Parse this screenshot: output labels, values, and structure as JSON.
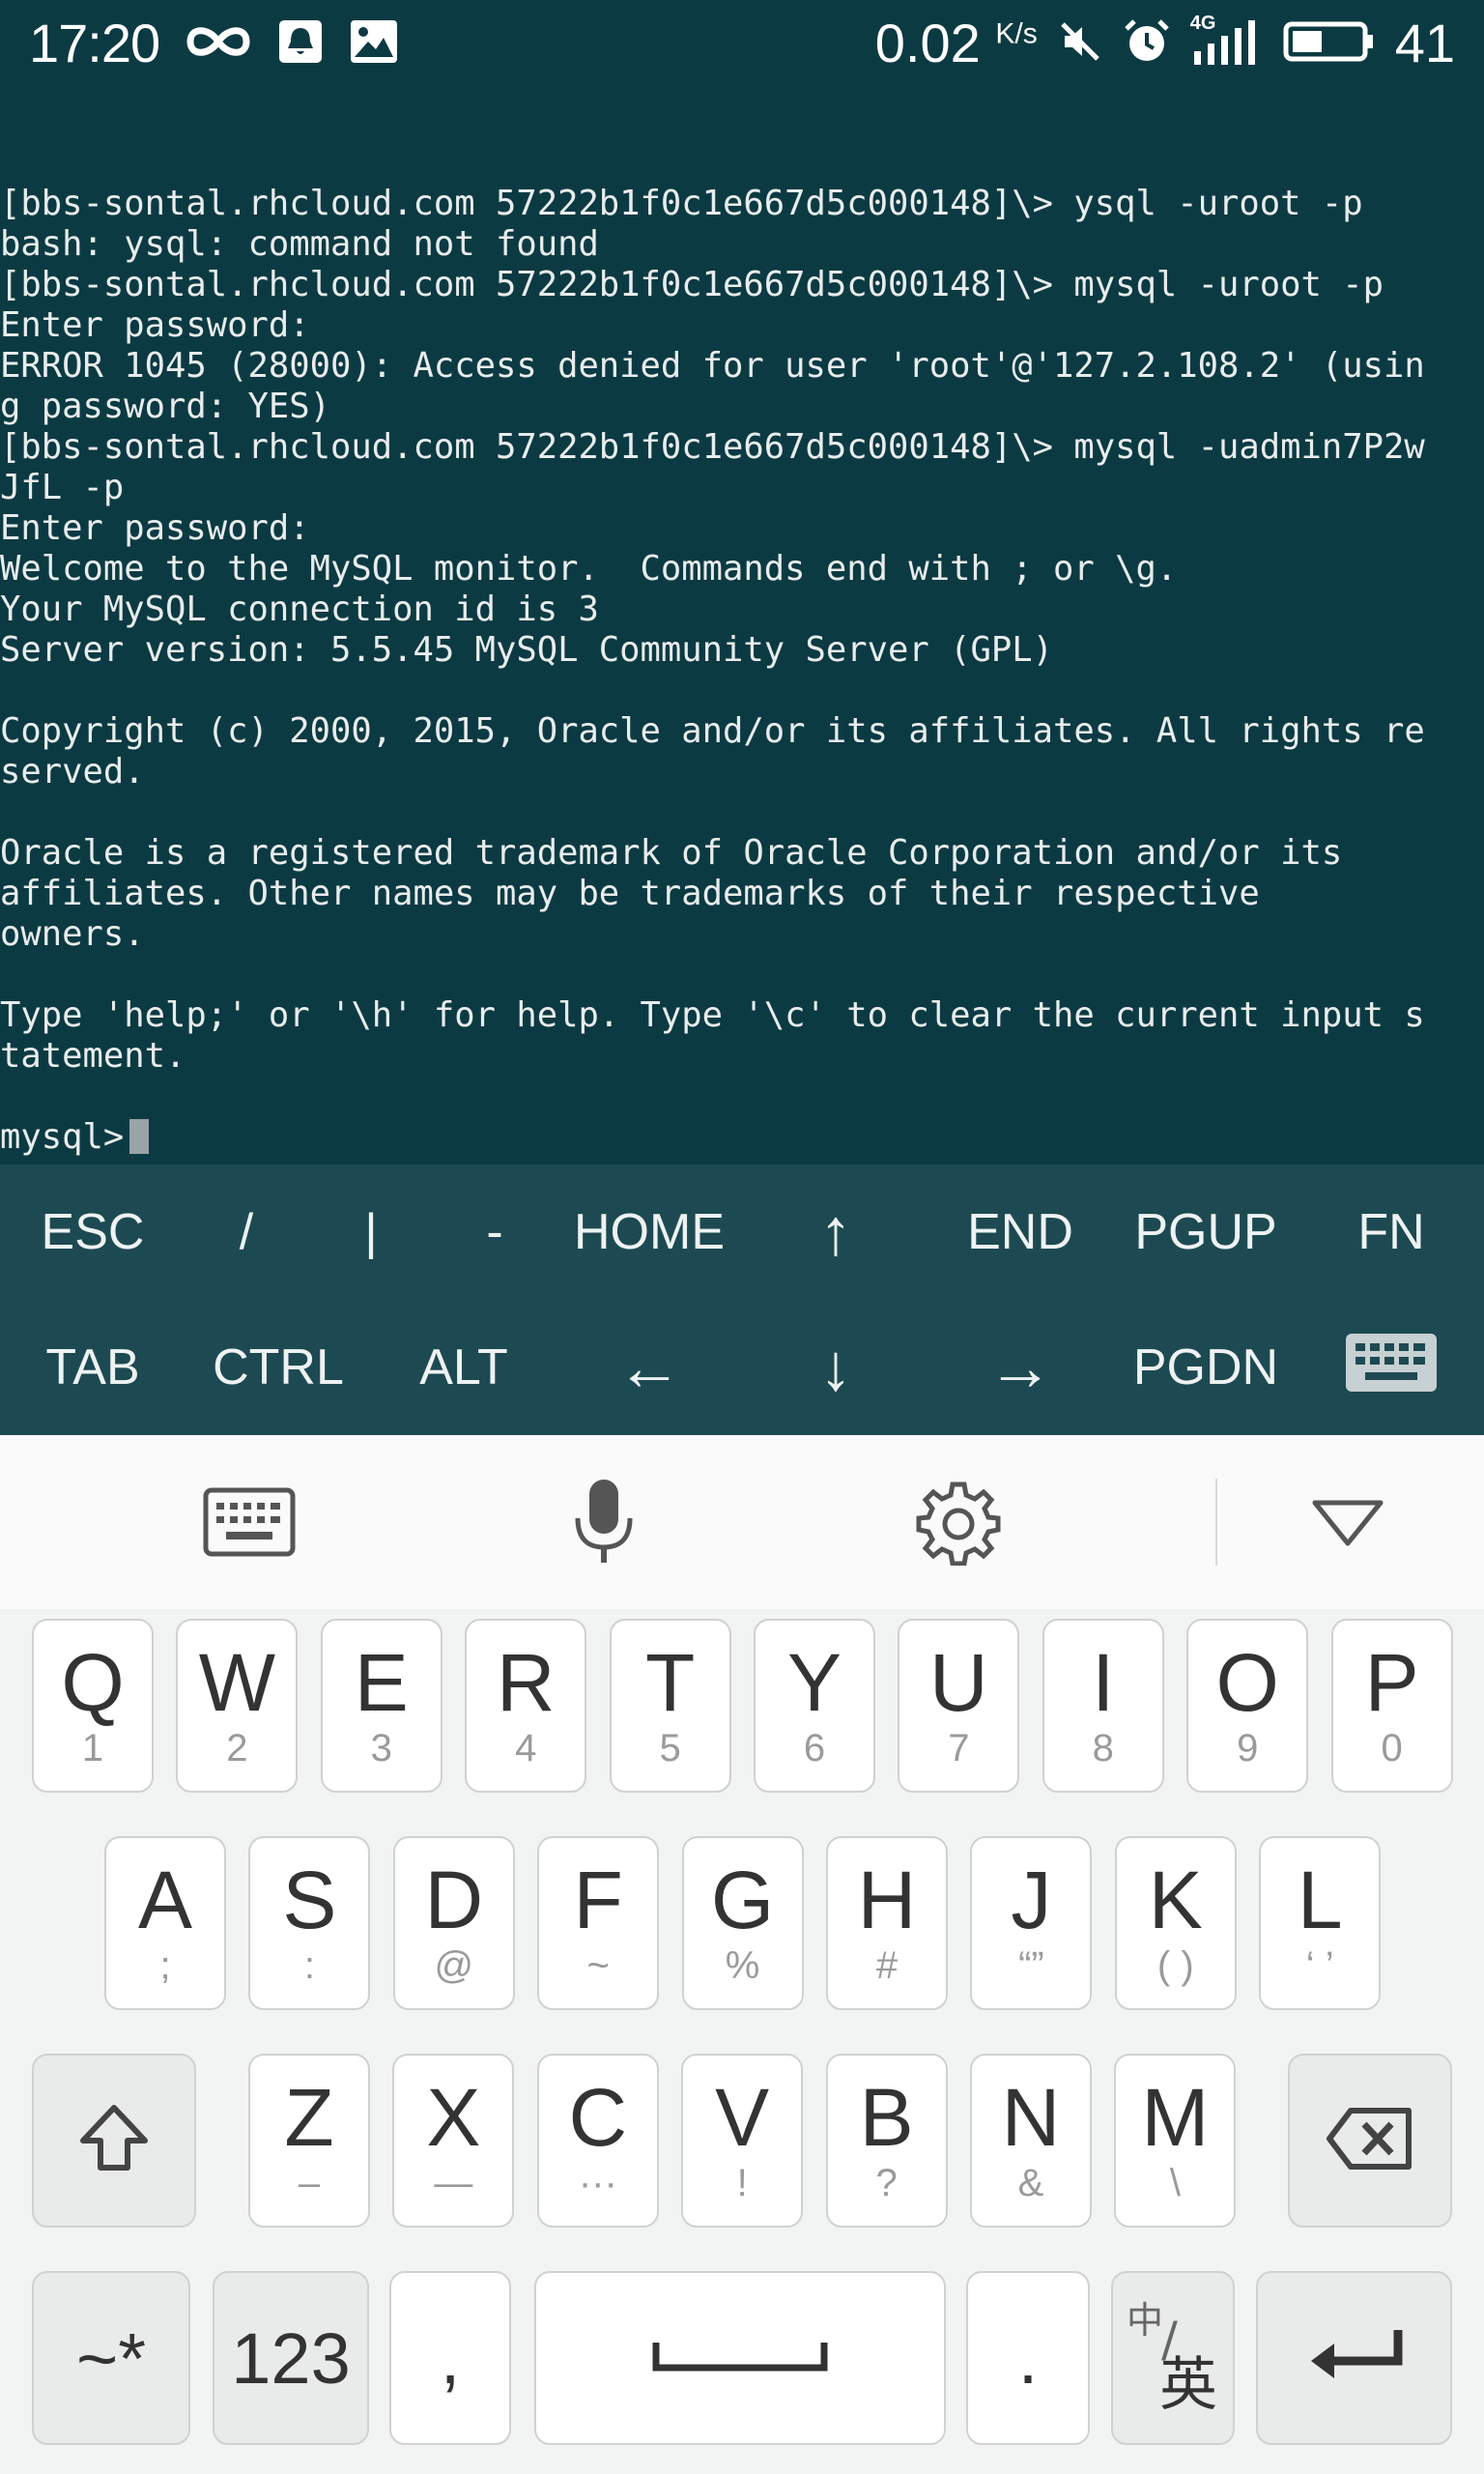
{
  "status_bar": {
    "time": "17:20",
    "net_speed": "0.02",
    "net_speed_unit": "K/s",
    "battery_level": "41",
    "icons": [
      "infinity-icon",
      "notification-icon",
      "image-icon",
      "mute-icon",
      "alarm-icon",
      "signal-icon",
      "battery-icon"
    ],
    "network_label": "4G"
  },
  "terminal": {
    "lines": [
      "[bbs-sontal.rhcloud.com 57222b1f0c1e667d5c000148]\\> ysql -uroot -p",
      "bash: ysql: command not found",
      "[bbs-sontal.rhcloud.com 57222b1f0c1e667d5c000148]\\> mysql -uroot -p",
      "Enter password:",
      "ERROR 1045 (28000): Access denied for user 'root'@'127.2.108.2' (usin",
      "g password: YES)",
      "[bbs-sontal.rhcloud.com 57222b1f0c1e667d5c000148]\\> mysql -uadmin7P2w",
      "JfL -p",
      "Enter password:",
      "Welcome to the MySQL monitor.  Commands end with ; or \\g.",
      "Your MySQL connection id is 3",
      "Server version: 5.5.45 MySQL Community Server (GPL)",
      "",
      "Copyright (c) 2000, 2015, Oracle and/or its affiliates. All rights re",
      "served.",
      "",
      "Oracle is a registered trademark of Oracle Corporation and/or its",
      "affiliates. Other names may be trademarks of their respective",
      "owners.",
      "",
      "Type 'help;' or '\\h' for help. Type '\\c' to clear the current input s",
      "tatement.",
      ""
    ],
    "prompt": "mysql>"
  },
  "extra_keys": {
    "row1": [
      "ESC",
      "/",
      "|",
      "-",
      "HOME",
      "↑",
      "END",
      "PGUP",
      "FN"
    ],
    "row2": [
      "TAB",
      "CTRL",
      "ALT",
      "←",
      "↓",
      "→",
      "PGDN"
    ]
  },
  "keyboard": {
    "row1": [
      {
        "k": "Q",
        "s": "1"
      },
      {
        "k": "W",
        "s": "2"
      },
      {
        "k": "E",
        "s": "3"
      },
      {
        "k": "R",
        "s": "4"
      },
      {
        "k": "T",
        "s": "5"
      },
      {
        "k": "Y",
        "s": "6"
      },
      {
        "k": "U",
        "s": "7"
      },
      {
        "k": "I",
        "s": "8"
      },
      {
        "k": "O",
        "s": "9"
      },
      {
        "k": "P",
        "s": "0"
      }
    ],
    "row2": [
      {
        "k": "A",
        "s": ";"
      },
      {
        "k": "S",
        "s": ":"
      },
      {
        "k": "D",
        "s": "@"
      },
      {
        "k": "F",
        "s": "~"
      },
      {
        "k": "G",
        "s": "%"
      },
      {
        "k": "H",
        "s": "#"
      },
      {
        "k": "J",
        "s": "“”"
      },
      {
        "k": "K",
        "s": "( )"
      },
      {
        "k": "L",
        "s": "‘ ’"
      }
    ],
    "row3": [
      {
        "k": "Z",
        "s": "–"
      },
      {
        "k": "X",
        "s": "—"
      },
      {
        "k": "C",
        "s": "···"
      },
      {
        "k": "V",
        "s": "!"
      },
      {
        "k": "B",
        "s": "?"
      },
      {
        "k": "N",
        "s": "&"
      },
      {
        "k": "M",
        "s": "\\"
      }
    ],
    "bottom": {
      "symbols": "~*",
      "numbers": "123",
      "comma": ",",
      "period": ".",
      "lang_top": "中",
      "lang_bottom": "英"
    }
  }
}
